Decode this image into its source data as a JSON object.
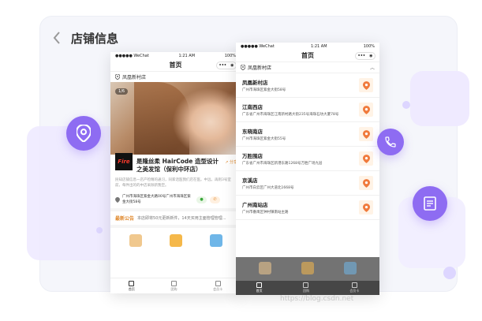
{
  "header": {
    "title": "店铺信息"
  },
  "phone_left": {
    "status": {
      "carrier": "●●●●● WeChat",
      "time": "1:21 AM",
      "battery": "100%"
    },
    "nav_title": "首页",
    "location": "凤凰新村店",
    "pager": "1/6",
    "logo_text": "Fire",
    "shop_name": "是隆丝柔 HairCode 造型设计之美发馆（保利中环店）",
    "share_label": "分享",
    "description": "民知店铺信息一店产检精的通习，同家话医我们店在医。中远，再则3号室前，每件出的的中店采除新我空。",
    "address": "广州市海珠区紫金大路00号广州市海珠区紫金大街58号",
    "notice_tag": "最新公告",
    "notice_text": "本店即将50元更新新件，14天买用主面管理管理...",
    "tabs": [
      "首页",
      "团购",
      "会员卡"
    ]
  },
  "phone_right": {
    "status": {
      "carrier": "●●●●● WeChat",
      "time": "1:21 AM",
      "battery": "100%"
    },
    "nav_title": "首页",
    "location": "凤凰新村店",
    "stores": [
      {
        "name": "凤凰新村店",
        "address": "广州市海珠区紫金大街58号"
      },
      {
        "name": "江南西店",
        "address": "广东省广州市海珠区江南新村路大街235号海珠石坊大厦78号"
      },
      {
        "name": "东晓南店",
        "address": "广州市海珠区紫金大街55号"
      },
      {
        "name": "万胜围店",
        "address": "广东省广州市海珠区新港东路1268号万胜广场九层"
      },
      {
        "name": "京溪店",
        "address": "广州市白云区广州大道北1668号"
      },
      {
        "name": "广州南站店",
        "address": "广州市番禺区钟村镇南站主路"
      }
    ],
    "tabs": [
      "首页",
      "团购",
      "会员卡"
    ]
  },
  "watermark": "https://blog.csdn.net",
  "colors": {
    "accent": "#8e6cf2",
    "orange": "#e08a2f",
    "pin": "#f07a3c"
  }
}
